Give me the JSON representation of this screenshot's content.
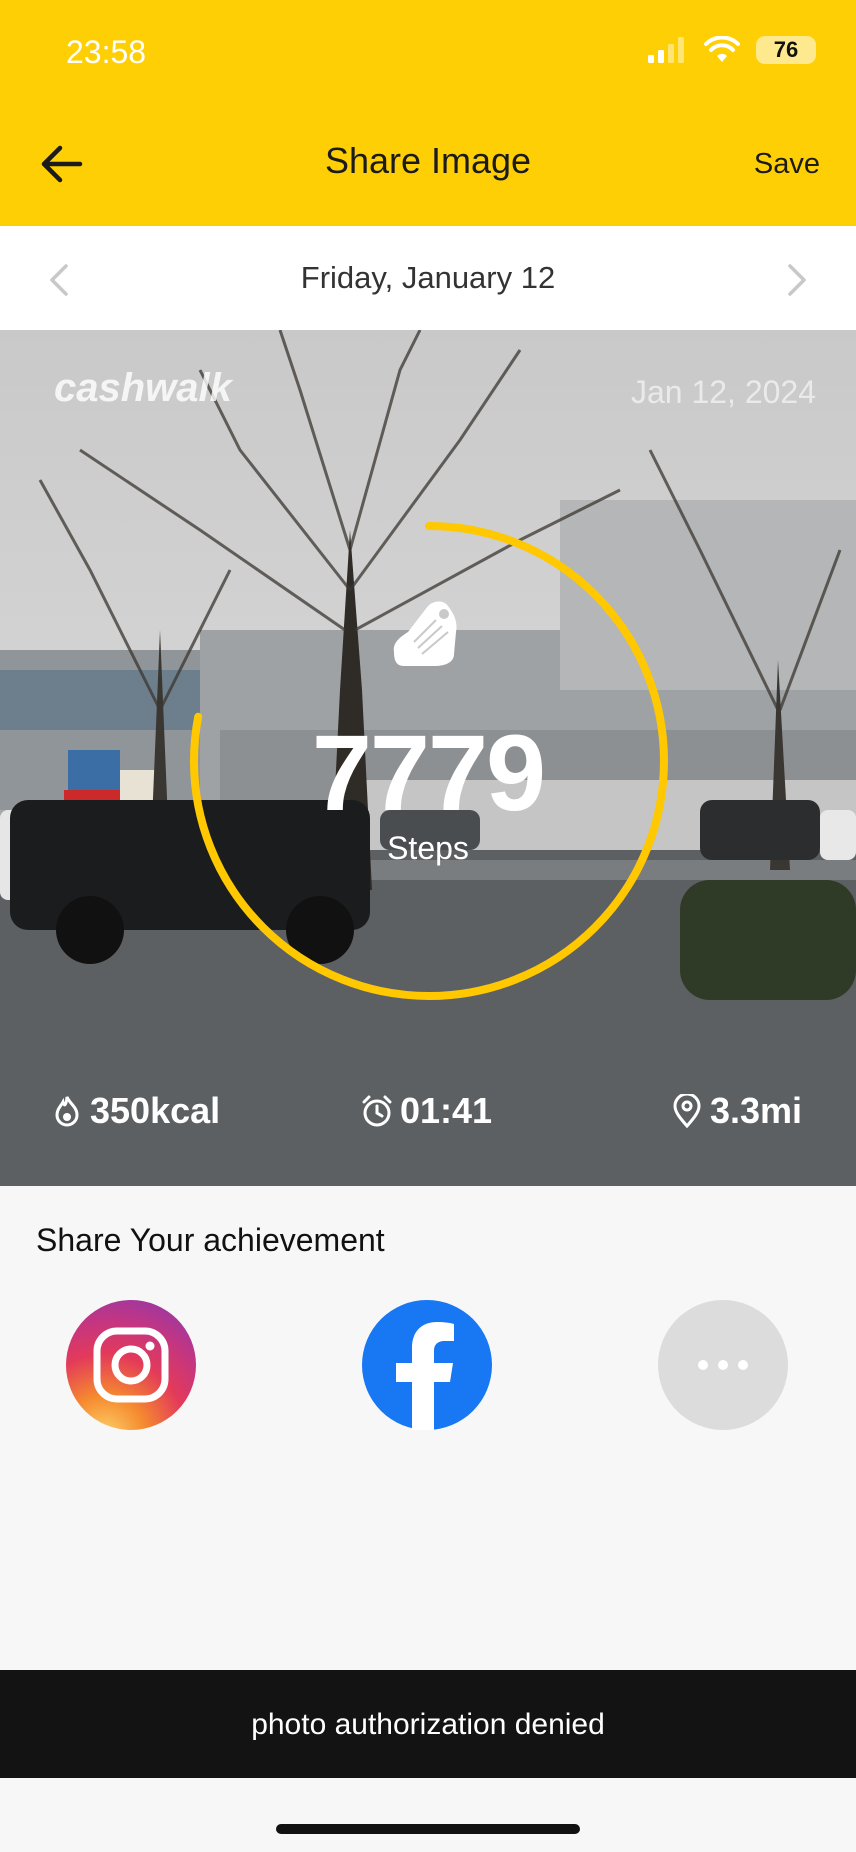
{
  "status_bar": {
    "time": "23:58",
    "battery": "76"
  },
  "header": {
    "title": "Share Image",
    "save_label": "Save"
  },
  "date_nav": {
    "date": "Friday, January 12"
  },
  "card": {
    "brand": "cashwalk",
    "date": "Jan 12, 2024",
    "steps": "7779",
    "steps_label": "Steps",
    "calories": "350kcal",
    "duration": "01:41",
    "distance": "3.3mi",
    "ring_progress": 0.78,
    "ring_color": "#ffc800"
  },
  "share": {
    "title": "Share Your achievement",
    "targets": [
      "instagram-icon",
      "facebook-icon",
      "more-icon"
    ]
  },
  "toast": {
    "message": "photo authorization denied"
  },
  "colors": {
    "header": "#ffcf06",
    "toast": "#131313",
    "facebook": "#1877f2"
  }
}
